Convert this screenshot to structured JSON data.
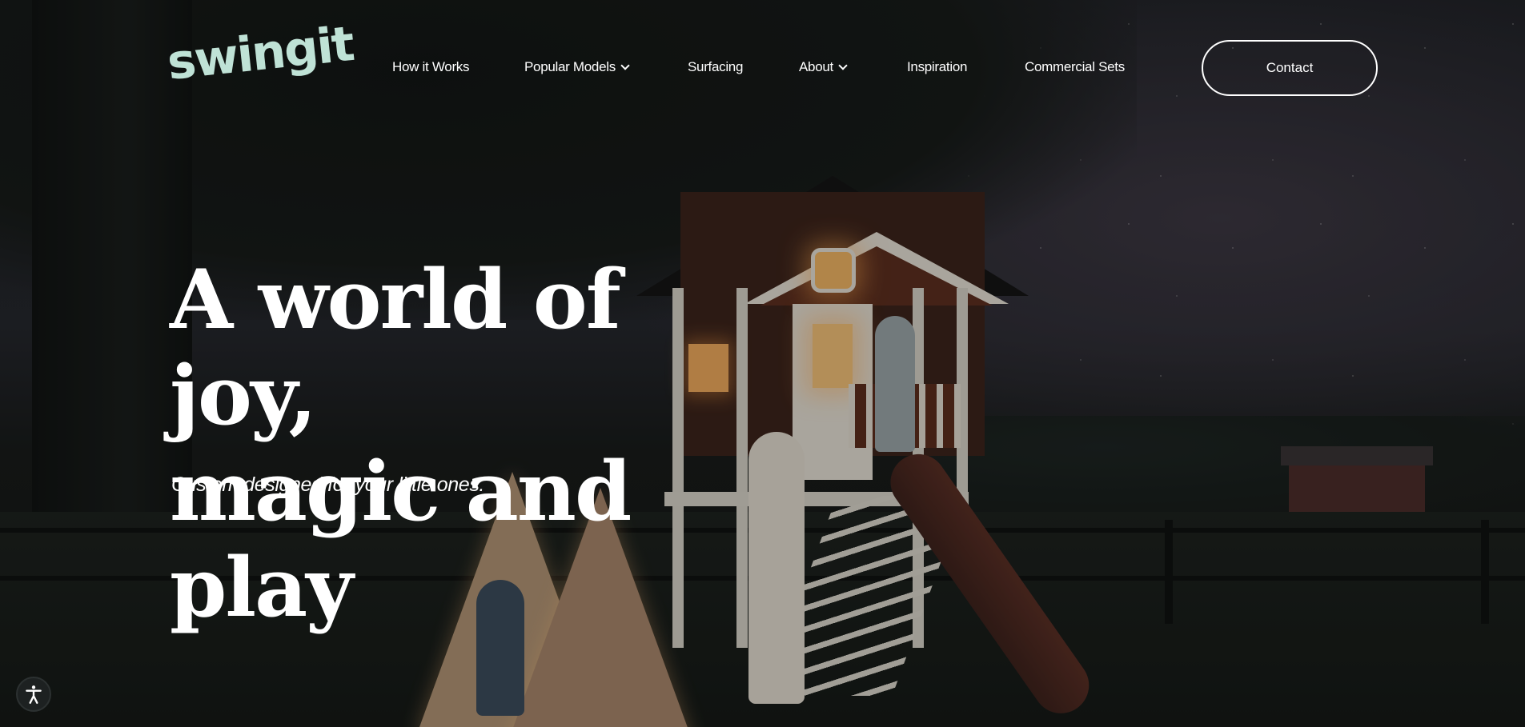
{
  "brand": {
    "logo_text": "swingit",
    "logo_color": "#bfe2d6"
  },
  "nav": {
    "items": [
      {
        "label": "How it Works",
        "has_dropdown": false
      },
      {
        "label": "Popular Models",
        "has_dropdown": true
      },
      {
        "label": "Surfacing",
        "has_dropdown": false
      },
      {
        "label": "About",
        "has_dropdown": true
      },
      {
        "label": "Inspiration",
        "has_dropdown": false
      },
      {
        "label": "Commercial Sets",
        "has_dropdown": false
      }
    ],
    "contact_label": "Contact"
  },
  "hero": {
    "title_line1": "A world of joy,",
    "title_line2": "magic and play",
    "subtitle": "Custom designed for your little ones."
  },
  "accessibility": {
    "icon": "accessibility-icon"
  },
  "colors": {
    "text": "#ffffff",
    "button_border": "#ffffff"
  }
}
